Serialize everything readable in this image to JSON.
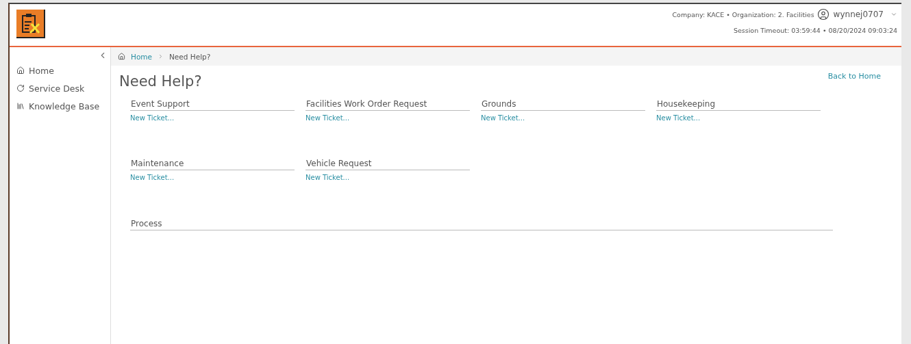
{
  "header": {
    "company": "Company: KACE • Organization: 2. Facilities",
    "user": "wynnej0707",
    "session": "Session Timeout: 03:59:44 • 08/20/2024 09:03:24"
  },
  "breadcrumb": [
    {
      "label": "Home",
      "kind": "link"
    },
    {
      "label": "Need Help?",
      "kind": "current"
    }
  ],
  "sidebar": {
    "items": [
      {
        "label": "Home",
        "kind": "home"
      },
      {
        "label": "Service Desk",
        "kind": "desk"
      },
      {
        "label": "Knowledge Base",
        "kind": "books"
      }
    ]
  },
  "page": {
    "title": "Need Help?",
    "back_link": "Back to Home"
  },
  "categories": [
    {
      "name": "Event Support",
      "link": "New Ticket..."
    },
    {
      "name": "Facilities Work Order Request",
      "link": "New Ticket..."
    },
    {
      "name": "Grounds",
      "link": "New Ticket..."
    },
    {
      "name": "Housekeeping",
      "link": "New Ticket..."
    },
    {
      "name": "Maintenance",
      "link": "New Ticket..."
    },
    {
      "name": "Vehicle Request",
      "link": "New Ticket..."
    }
  ],
  "process": {
    "title": "Process"
  }
}
